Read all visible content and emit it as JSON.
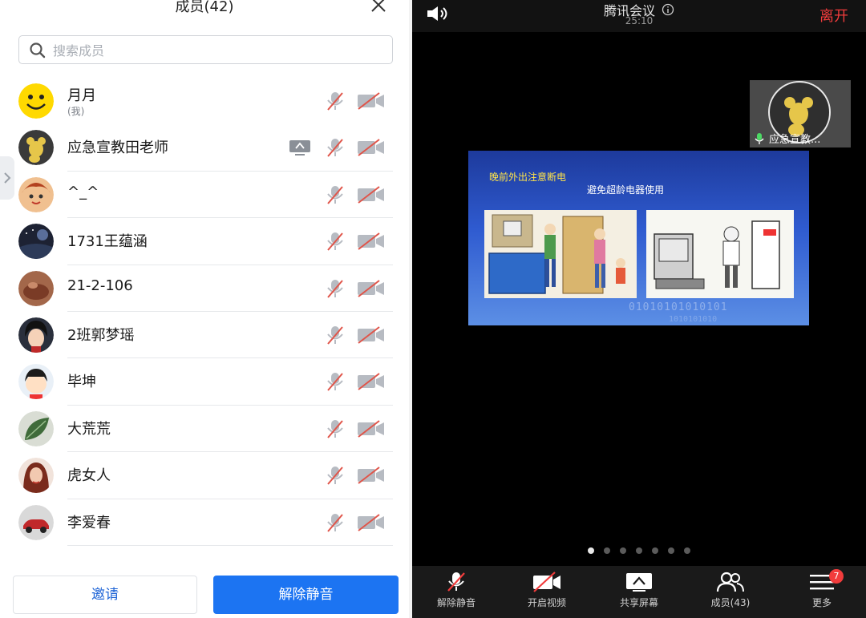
{
  "colors": {
    "accent": "#1c74f2",
    "leave": "#f23c3c",
    "muted_icon": "#b7bbc2",
    "muted_slash": "#e0554a"
  },
  "panel": {
    "title": "成员(42)",
    "close_icon": "close-icon",
    "search_placeholder": "搜索成员"
  },
  "members": [
    {
      "name": "月月",
      "sub": "(我)",
      "avatar": "smiley",
      "sharing": false
    },
    {
      "name": "应急宣教田老师",
      "sub": "",
      "avatar": "bear",
      "sharing": true
    },
    {
      "name": "^_^",
      "sub": "",
      "avatar": "cartoon-girl",
      "sharing": false
    },
    {
      "name": "1731王蕴涵",
      "sub": "",
      "avatar": "night-sky",
      "sharing": false
    },
    {
      "name": "21-2-106",
      "sub": "",
      "avatar": "brown-photo",
      "sharing": false
    },
    {
      "name": "2班郭梦瑶",
      "sub": "",
      "avatar": "anime-girl",
      "sharing": false
    },
    {
      "name": "毕坤",
      "sub": "",
      "avatar": "maruko",
      "sharing": false
    },
    {
      "name": "大荒荒",
      "sub": "",
      "avatar": "leaf",
      "sharing": false
    },
    {
      "name": "虎女人",
      "sub": "",
      "avatar": "portrait-woman",
      "sharing": false
    },
    {
      "name": "李爱春",
      "sub": "",
      "avatar": "red-car",
      "sharing": false
    }
  ],
  "actions": {
    "invite_label": "邀请",
    "unmute_label": "解除静音"
  },
  "meeting": {
    "title": "腾讯会议",
    "timer": "25:10",
    "leave_label": "离开",
    "speaker_name": "应急宣教...",
    "slide_line1": "晚前外出注意断电",
    "slide_line2": "避免超龄电器使用",
    "slide_binary": "01010101010101",
    "slide_binary2": "1010101010",
    "page_count": 7,
    "active_page": 1
  },
  "toolbar": {
    "unmute": "解除静音",
    "start_video": "开启视频",
    "share_screen": "共享屏幕",
    "members": "成员(43)",
    "more": "更多",
    "more_badge": "7"
  }
}
